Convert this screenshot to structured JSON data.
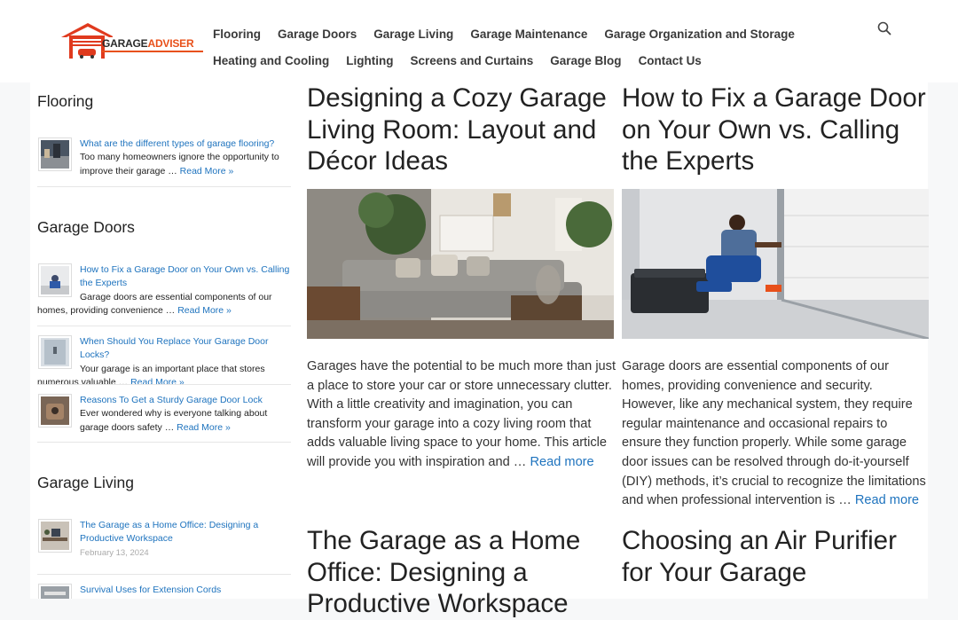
{
  "logo": {
    "text_a": "GARAGE",
    "text_b": "ADVISER"
  },
  "nav": {
    "row1": [
      "Flooring",
      "Garage Doors",
      "Garage Living",
      "Garage Maintenance",
      "Garage Organization and Storage"
    ],
    "row2": [
      "Heating and Cooling",
      "Lighting",
      "Screens and Curtains",
      "Garage Blog",
      "Contact Us"
    ]
  },
  "sidebar": {
    "flooring": {
      "title": "Flooring",
      "posts": [
        {
          "title": "What are the different types of garage flooring?",
          "excerpt": "Too many homeowners ignore the opportunity to improve their garage …",
          "more": "Read More »"
        }
      ]
    },
    "doors": {
      "title": "Garage Doors",
      "posts": [
        {
          "title": "How to Fix a Garage Door on Your Own vs. Calling the Experts",
          "excerpt": "Garage doors are essential components of our homes, providing convenience …",
          "more": "Read More »"
        },
        {
          "title": "When Should You Replace Your Garage Door Locks?",
          "excerpt": "Your garage is an important place that stores numerous valuable …",
          "more": "Read More »"
        },
        {
          "title": "Reasons To Get a Sturdy Garage Door Lock",
          "excerpt": "Ever wondered why is everyone talking about garage doors safety …",
          "more": "Read More »"
        }
      ]
    },
    "living": {
      "title": "Garage Living",
      "posts": [
        {
          "title": "The Garage as a Home Office: Designing a Productive Workspace",
          "date": "February 13, 2024"
        },
        {
          "title": "Survival Uses for Extension Cords"
        }
      ]
    }
  },
  "articles": [
    {
      "title": "Designing a Cozy Garage Living Room: Layout and Décor Ideas",
      "excerpt": "Garages have the potential to be much more than just a place to store your car or store unnecessary clutter. With a little creativity and imagination, you can transform your garage into a cozy living room that adds valuable living space to your home. This article will provide you with inspiration and …",
      "more": "Read more"
    },
    {
      "title": "How to Fix a Garage Door on Your Own vs. Calling the Experts",
      "excerpt": "Garage doors are essential components of our homes, providing convenience and security. However, like any mechanical system, they require regular maintenance and occasional repairs to ensure they function properly. While some garage door issues can be resolved through do-it-yourself (DIY) methods, it’s crucial to recognize the limitations and when professional intervention is …",
      "more": "Read more"
    },
    {
      "title": "The Garage as a Home Office: Designing a Productive Workspace"
    },
    {
      "title": "Choosing an Air Purifier for Your Garage"
    }
  ],
  "colors": {
    "link": "#1e73be",
    "accent": "#e8501a",
    "logo_red": "#e03a1e"
  }
}
